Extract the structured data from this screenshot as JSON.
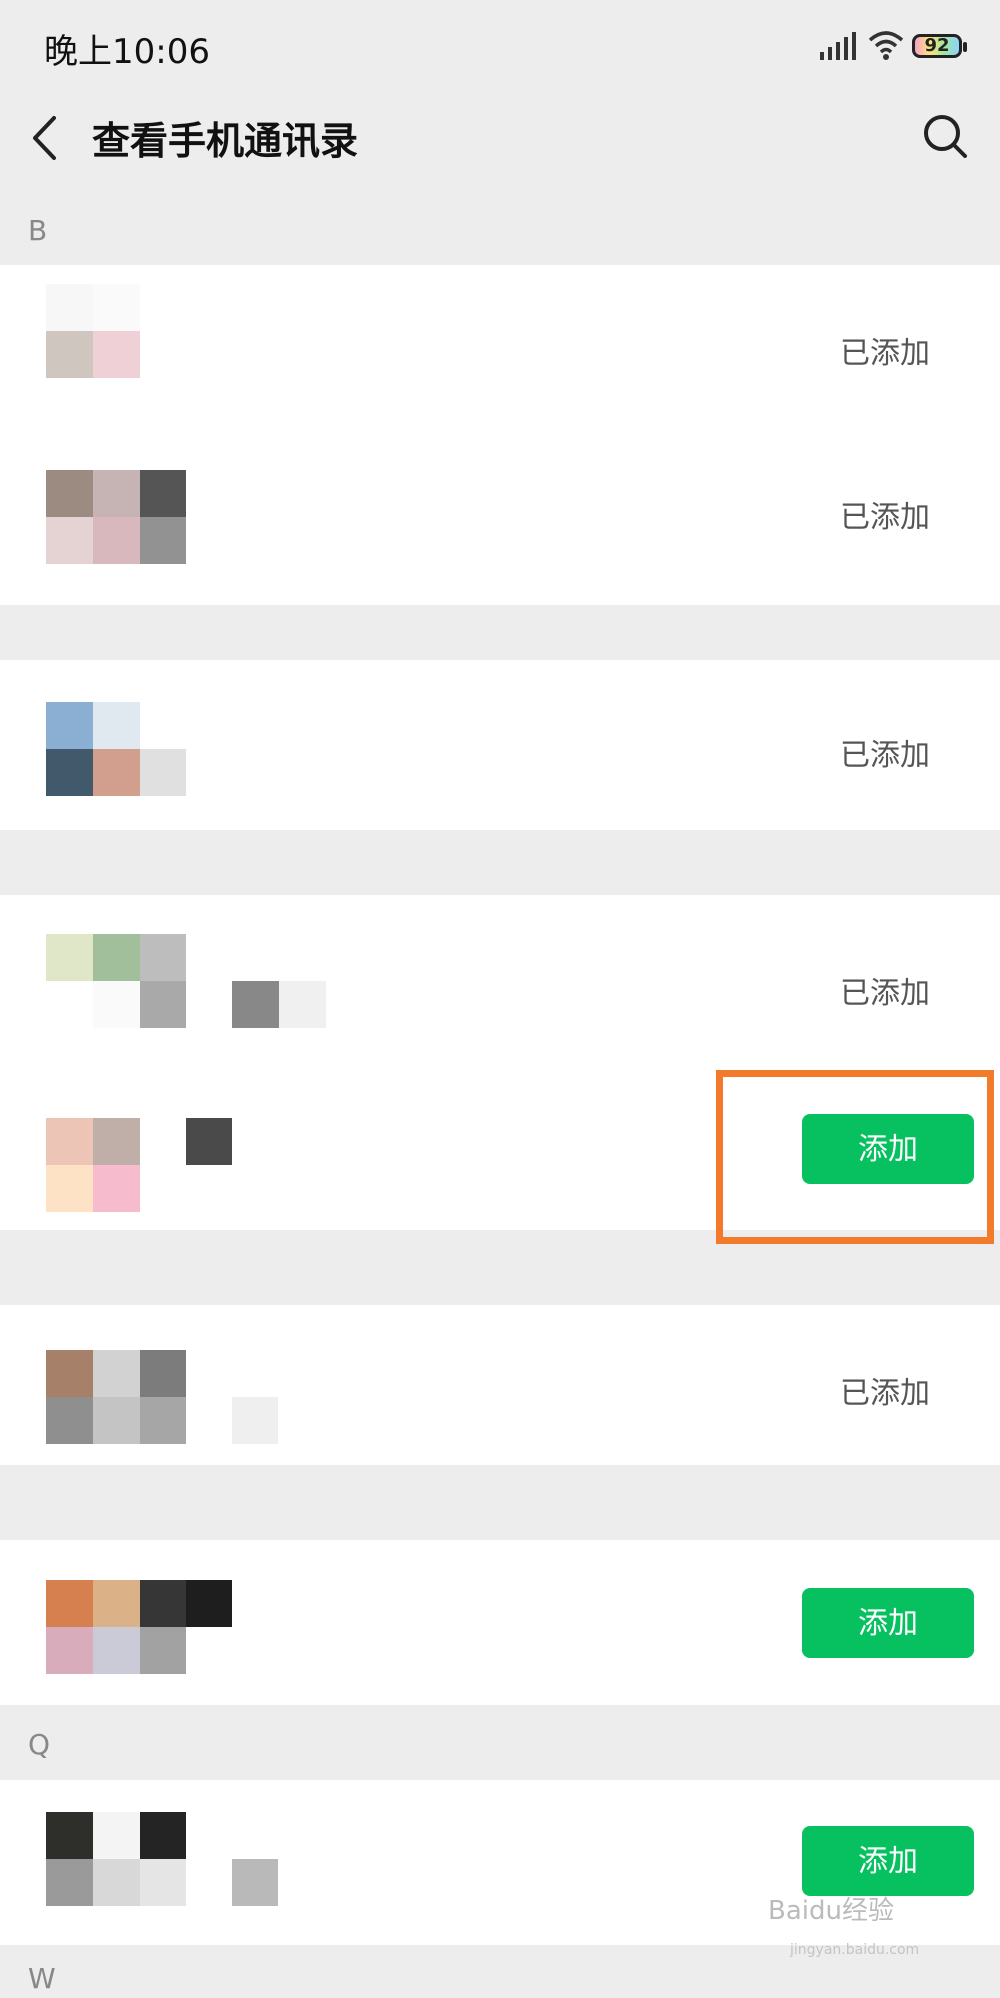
{
  "status_bar": {
    "time": "晚上10:06",
    "battery": "92"
  },
  "header": {
    "title": "查看手机通讯录",
    "back_icon": "chevron-left-icon",
    "search_icon": "search-icon"
  },
  "sections": {
    "b": "B",
    "q": "Q",
    "w": "W"
  },
  "contacts": [
    {
      "status": "已添加"
    },
    {
      "status": "已添加"
    },
    {
      "status": "已添加"
    },
    {
      "status": "已添加"
    },
    {
      "status": "添加"
    },
    {
      "status": "已添加"
    },
    {
      "status": "添加"
    },
    {
      "status": "添加"
    }
  ],
  "colors": {
    "accent_green": "#07c160",
    "highlight_orange": "#f47a2b",
    "background": "#ededed"
  },
  "watermark": {
    "main": "Baidu经验",
    "sub": "jingyan.baidu.com"
  }
}
